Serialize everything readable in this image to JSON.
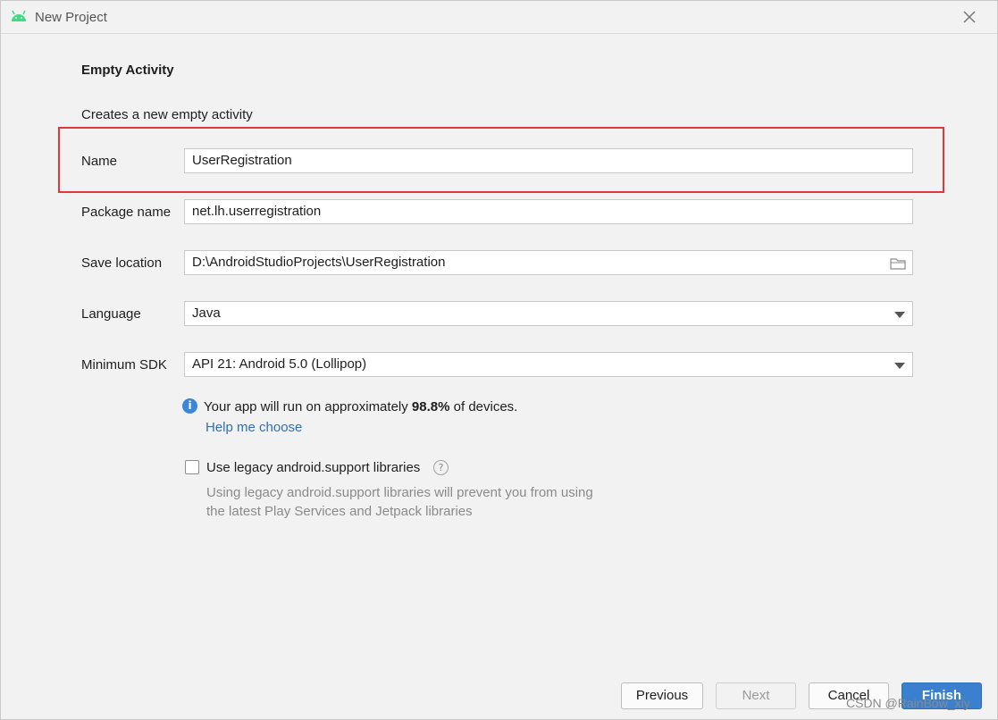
{
  "window": {
    "title": "New Project"
  },
  "content": {
    "heading": "Empty Activity",
    "description": "Creates a new empty activity"
  },
  "form": {
    "name": {
      "label": "Name",
      "value": "UserRegistration"
    },
    "package": {
      "label": "Package name",
      "value": "net.lh.userregistration"
    },
    "location": {
      "label": "Save location",
      "value": "D:\\AndroidStudioProjects\\UserRegistration"
    },
    "language": {
      "label": "Language",
      "value": "Java"
    },
    "min_sdk": {
      "label": "Minimum SDK",
      "value": "API 21: Android 5.0 (Lollipop)"
    }
  },
  "info": {
    "prefix": "Your app will run on approximately ",
    "percent": "98.8%",
    "suffix": " of devices.",
    "help_link": "Help me choose"
  },
  "legacy": {
    "checked": false,
    "label": "Use legacy android.support libraries",
    "note_line1": "Using legacy android.support libraries will prevent you from using",
    "note_line2": "the latest Play Services and Jetpack libraries"
  },
  "buttons": {
    "previous": "Previous",
    "next": "Next",
    "cancel": "Cancel",
    "finish": "Finish"
  },
  "watermark": "CSDN @RainBow_xiy",
  "colors": {
    "highlight_box": "#e0393a",
    "primary_button": "#3b7fcf",
    "link": "#2f6fb8",
    "android_icon": "#3ddc84"
  },
  "icons": [
    "android-icon",
    "close-icon",
    "folder-icon",
    "dropdown-arrow-icon",
    "info-icon",
    "help-question-icon"
  ]
}
